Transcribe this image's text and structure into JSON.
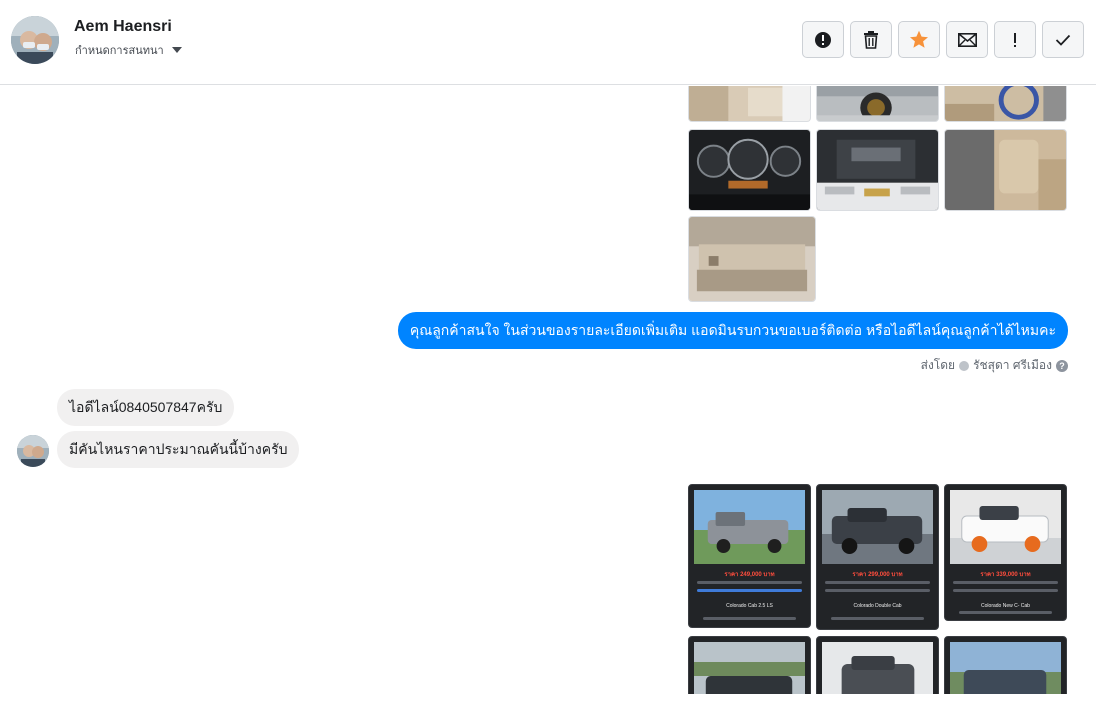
{
  "header": {
    "contact_name": "Aem Haensri",
    "assign_label": "กำหนดการสนทนา",
    "actions": [
      {
        "name": "report-spam-button",
        "icon": "alert-circle-icon"
      },
      {
        "name": "delete-button",
        "icon": "trash-icon"
      },
      {
        "name": "star-button",
        "icon": "star-icon"
      },
      {
        "name": "mark-unread-button",
        "icon": "envelope-icon"
      },
      {
        "name": "follow-up-button",
        "icon": "exclamation-icon"
      },
      {
        "name": "mark-done-button",
        "icon": "check-icon"
      }
    ],
    "star_color": "#f7923a"
  },
  "thread": {
    "outgoing_message": "คุณลูกค้าสนใจ ในส่วนของรายละเอียดเพิ่มเติม แอดมินรบกวนขอเบอร์ติดต่อ หรือไอดีไลน์คุณลูกค้าได้ไหมคะ",
    "sent_by_prefix": "ส่งโดย",
    "sent_by_name": "รัชสุดา ศรีเมือง",
    "incoming_messages": [
      "ไอดีไลน์0840507847ครับ",
      "มีคันไหนราคาประมาณคันนี้บ้างครับ"
    ],
    "promo_cards": [
      {
        "price": "ราคา 249,000 บาท",
        "model": "Colorado Cab 2.5 LS"
      },
      {
        "price": "ราคา 299,000 บาท",
        "model": "Colorado Double Cab"
      },
      {
        "price": "ราคา 339,000 บาท",
        "model": "Colorado New C- Cab"
      }
    ],
    "bubble_color": "#0084ff"
  }
}
